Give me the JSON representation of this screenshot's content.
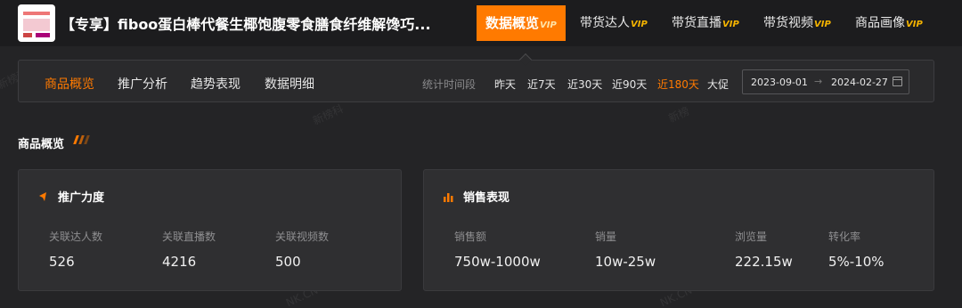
{
  "header": {
    "title": "【专享】fiboo蛋白棒代餐生椰饱腹零食膳食纤维解馋巧...",
    "nav": [
      {
        "label": "数据概览",
        "vip": "VIP",
        "active": true
      },
      {
        "label": "带货达人",
        "vip": "VIP",
        "active": false
      },
      {
        "label": "带货直播",
        "vip": "VIP",
        "active": false
      },
      {
        "label": "带货视频",
        "vip": "VIP",
        "active": false
      },
      {
        "label": "商品画像",
        "vip": "VIP",
        "active": false
      }
    ]
  },
  "filter": {
    "tabs": [
      "商品概览",
      "推广分析",
      "趋势表现",
      "数据明细"
    ],
    "active_tab": "商品概览",
    "period_label": "统计时间段",
    "ranges": [
      "昨天",
      "近7天",
      "近30天",
      "近90天",
      "近180天",
      "大促"
    ],
    "active_range": "近180天",
    "date_start": "2023-09-01",
    "date_end": "2024-02-27"
  },
  "section": {
    "title": "商品概览"
  },
  "promo_card": {
    "title": "推广力度",
    "metrics": [
      {
        "label": "关联达人数",
        "value": "526"
      },
      {
        "label": "关联直播数",
        "value": "4216"
      },
      {
        "label": "关联视频数",
        "value": "500"
      }
    ]
  },
  "sales_card": {
    "title": "销售表现",
    "metrics": [
      {
        "label": "销售额",
        "value": "750w-1000w"
      },
      {
        "label": "销量",
        "value": "10w-25w"
      },
      {
        "label": "浏览量",
        "value": "222.15w"
      },
      {
        "label": "转化率",
        "value": "5%-10%"
      }
    ]
  },
  "watermarks": [
    "新榜科",
    "新榜科",
    "新榜",
    "NK.CN",
    "NK.CN"
  ],
  "colors": {
    "accent": "#ff7a00",
    "vip": "#f5b400",
    "background": "#242426"
  }
}
